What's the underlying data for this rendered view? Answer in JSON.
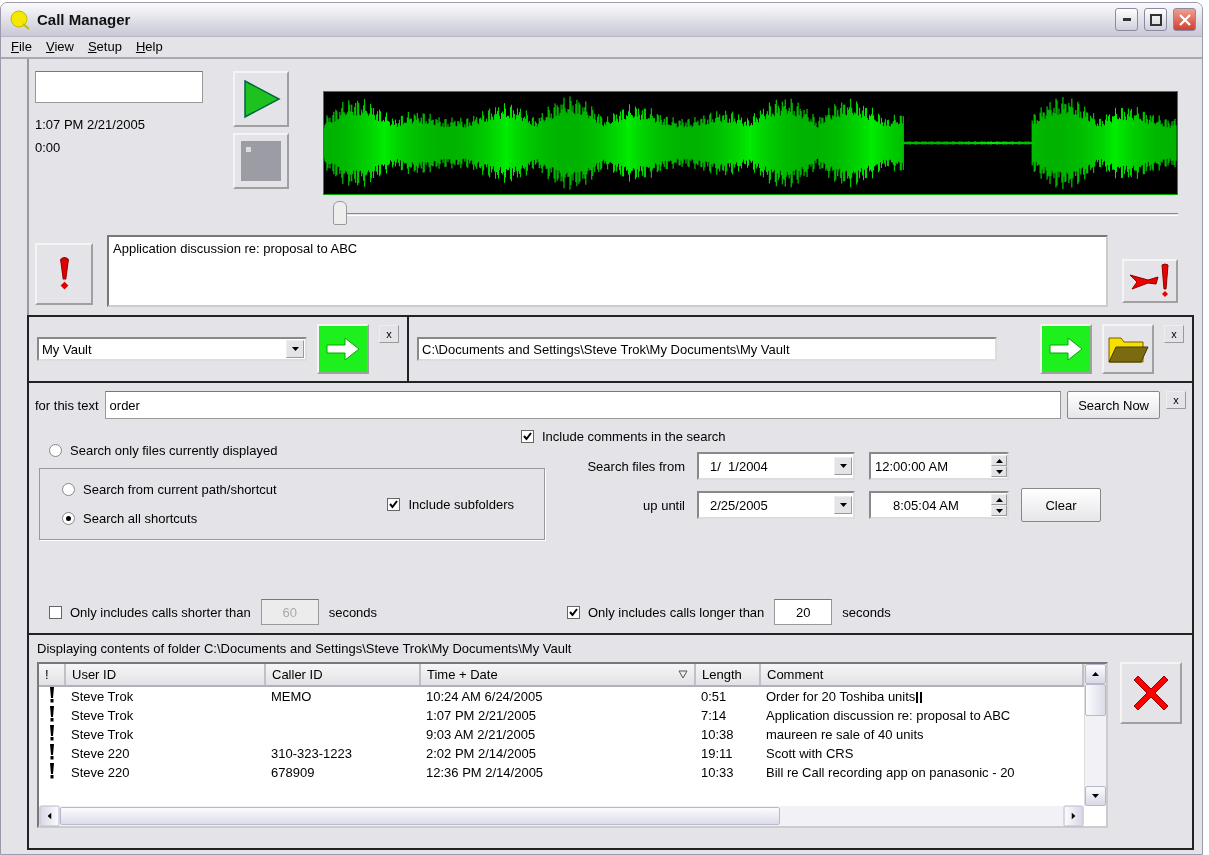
{
  "window": {
    "title": "Call Manager"
  },
  "menu": [
    "File",
    "View",
    "Setup",
    "Help"
  ],
  "player": {
    "time": "1:07 PM 2/21/2005",
    "position": "0:00",
    "seek": {
      "level": 0
    },
    "comment": "Application discussion re: proposal to ABC"
  },
  "vault": {
    "shortcut": "My Vault",
    "path": "C:\\Documents and Settings\\Steve Trok\\My Documents\\My Vault",
    "close_buttons": [
      "x",
      "x"
    ]
  },
  "search": {
    "label": "for this text",
    "query": "order",
    "button": "Search Now",
    "close_button": "x",
    "scope_options": [
      {
        "label": "Search only files currently displayed",
        "selected": false
      },
      {
        "label": "Search from current path/shortcut",
        "selected": false
      },
      {
        "label": "Search all shortcuts",
        "selected": true
      }
    ],
    "include_comments": {
      "label": "Include comments in the search",
      "checked": true
    },
    "include_subfolders": {
      "label": "Include subfolders",
      "checked": true
    },
    "from_label": "Search files from",
    "from_date": "1/  1/2004",
    "from_time": "12:00:00 AM",
    "until_label": "up until",
    "until_date": "2/25/2005",
    "until_time": "8:05:04 AM",
    "clear_button": "Clear",
    "shorter": {
      "label": "Only includes calls shorter than",
      "checked": false,
      "value": "60",
      "unit": "seconds"
    },
    "longer": {
      "label": "Only includes calls longer than",
      "checked": true,
      "value": "20",
      "unit": "seconds"
    }
  },
  "list": {
    "caption": "Displaying contents of folder C:\\Documents and Settings\\Steve Trok\\My Documents\\My Vault",
    "columns": [
      {
        "label": "!",
        "sorted": false
      },
      {
        "label": "User ID",
        "sorted": false
      },
      {
        "label": "Caller ID",
        "sorted": false
      },
      {
        "label": "Time + Date",
        "sorted": true
      },
      {
        "label": "Length",
        "sorted": false
      },
      {
        "label": "Comment",
        "sorted": false
      }
    ],
    "rows": [
      {
        "flagged": true,
        "user": "Steve Trok",
        "caller": "MEMO",
        "time": "10:24 AM 6/24/2005",
        "length": "0:51",
        "comment": "Order for 20 Toshiba units"
      },
      {
        "flagged": true,
        "user": "Steve Trok",
        "caller": "",
        "time": "1:07 PM 2/21/2005",
        "length": "7:14",
        "comment": "Application discussion re: proposal to ABC"
      },
      {
        "flagged": true,
        "user": "Steve Trok",
        "caller": "",
        "time": "9:03 AM 2/21/2005",
        "length": "10:38",
        "comment": "maureen re sale of 40 units"
      },
      {
        "flagged": true,
        "user": "Steve 220",
        "caller": "310-323-1223",
        "time": "2:02 PM 2/14/2005",
        "length": "19:11",
        "comment": "Scott with CRS"
      },
      {
        "flagged": true,
        "user": "Steve 220",
        "caller": "678909",
        "time": "12:36 PM 2/14/2005",
        "length": "10:33",
        "comment": "Bill re Call recording app on panasonic - 20"
      }
    ]
  }
}
